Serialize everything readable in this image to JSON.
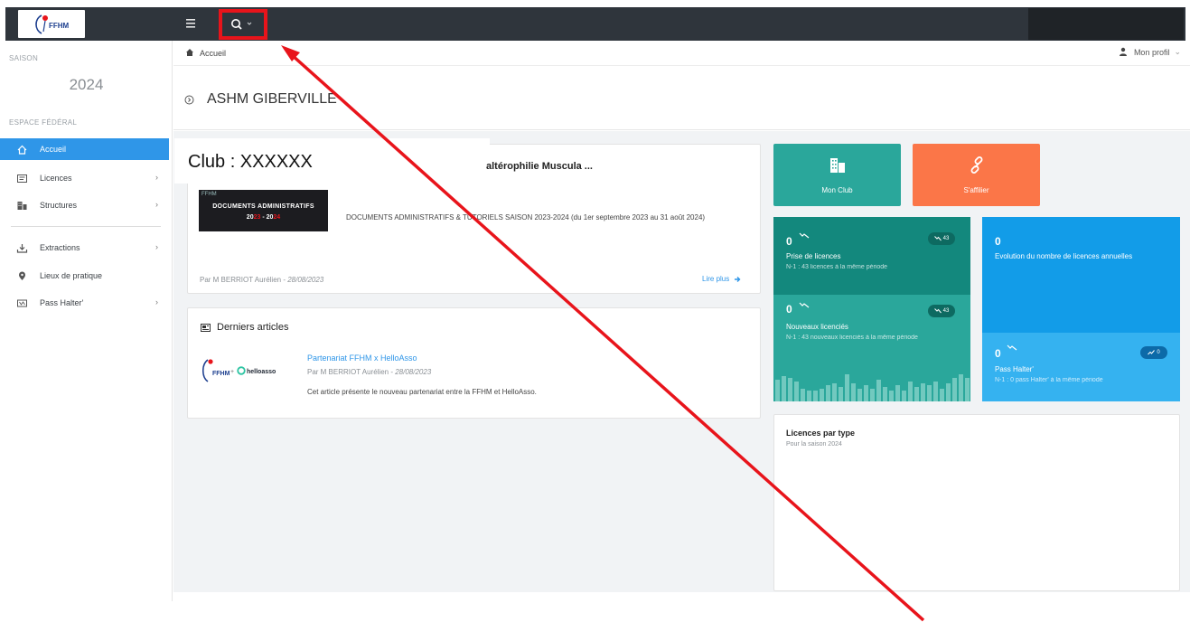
{
  "app": {
    "logo_text": "FFHM",
    "colors": {
      "topbar": "#2f353c",
      "active": "#2f96e8",
      "annotation": "#e8141b"
    }
  },
  "topbar": {
    "menu_icon": "hamburger-menu-icon",
    "search_icon": "search-icon",
    "search_caret": "⌄"
  },
  "sidebar": {
    "saison_label": "SAISON",
    "year": "2024",
    "espace_label": "ESPACE FÉDÉRAL",
    "items": [
      {
        "label": "Accueil",
        "icon": "home-icon",
        "chevron": "",
        "active": true
      },
      {
        "label": "Licences",
        "icon": "license-card-icon",
        "chevron": "›"
      },
      {
        "label": "Structures",
        "icon": "building-icon",
        "chevron": "›"
      },
      {
        "label": "Extractions",
        "icon": "download-icon",
        "chevron": "›"
      },
      {
        "label": "Lieux de pratique",
        "icon": "map-pin-icon",
        "chevron": ""
      },
      {
        "label": "Pass Halter'",
        "icon": "ticket-icon",
        "chevron": "›"
      }
    ]
  },
  "breadcrumb": {
    "home": "Accueil",
    "profile": "Mon profil",
    "profile_caret": "⌄"
  },
  "title": "ASHM GIBERVILLE",
  "news": {
    "club_label": "Club : XXXXXX",
    "title_visible": "altérophilie Muscula ...",
    "thumb_logo": "FFHM",
    "thumb_line1": "DOCUMENTS ADMINISTRATIFS",
    "thumb_line2_a": "20",
    "thumb_line2_b": "23",
    "thumb_line2_c": " - 20",
    "thumb_line2_d": "24",
    "description": "DOCUMENTS ADMINISTRATIFS & TUTORIELS SAISON 2023-2024 (du 1er septembre 2023 au 31 août 2024)",
    "author": "Par M BERRIOT Aurélien - ",
    "date": "28/08/2023",
    "read_more": "Lire plus"
  },
  "articles": {
    "heading": "Derniers articles",
    "items": [
      {
        "title": "Partenariat FFHM x HelloAsso",
        "author": "Par M BERRIOT Aurélien - ",
        "date": "28/08/2023",
        "description": "Cet article présente le nouveau partenariat entre la FFHM et HelloAsso.",
        "thumb_logo": "FFHM",
        "thumb_plus": "+",
        "thumb_partner": "helloasso"
      }
    ]
  },
  "tiles": {
    "club": "Mon Club",
    "affiliate": "S'affilier"
  },
  "stats": {
    "prise": {
      "value": "0",
      "title": "Prise de licences",
      "sub": "N-1 : 43 licences à la même période",
      "badge": "43"
    },
    "nouveaux": {
      "value": "0",
      "title": "Nouveaux licenciés",
      "sub": "N-1 : 43 nouveaux licenciés à la même période",
      "badge": "43"
    },
    "evolution": {
      "value": "0",
      "title": "Evolution du nombre de licences annuelles"
    },
    "pass": {
      "value": "0",
      "title": "Pass Halter'",
      "sub": "N-1 : 0 pass Halter' à la même période",
      "badge": "0"
    }
  },
  "licences_type": {
    "title": "Licences par type",
    "sub": "Pour la saison 2024"
  }
}
